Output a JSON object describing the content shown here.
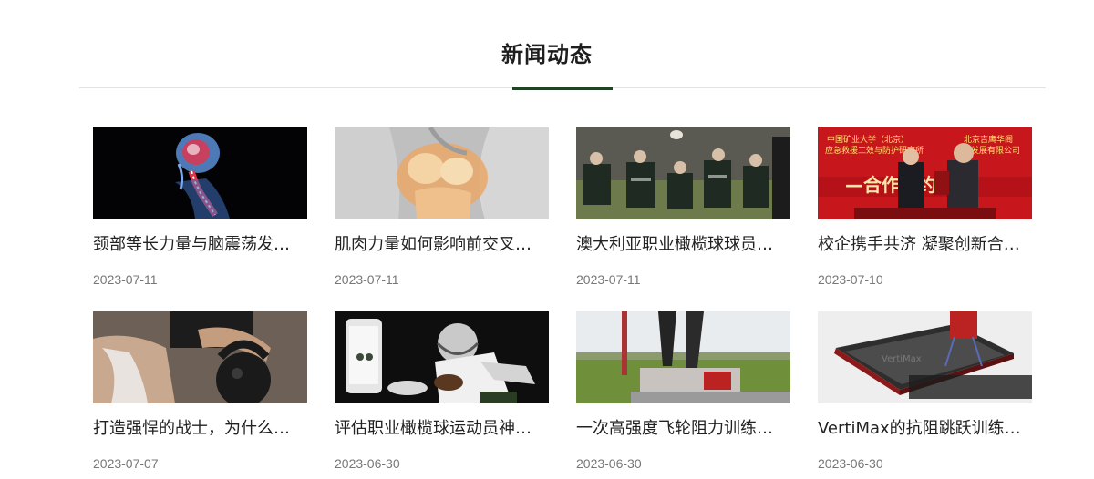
{
  "section": {
    "title": "新闻动态"
  },
  "news": [
    {
      "title": "颈部等长力量与脑震荡发…",
      "date": "2023-07-11",
      "image": "spine-brain-xray-image"
    },
    {
      "title": "肌肉力量如何影响前交叉…",
      "date": "2023-07-11",
      "image": "knee-joint-image"
    },
    {
      "title": "澳大利亚职业橄榄球球员…",
      "date": "2023-07-11",
      "image": "rugby-players-image"
    },
    {
      "title": "校企携手共济 凝聚创新合…",
      "date": "2023-07-10",
      "image": "partnership-signing-image"
    },
    {
      "title": "打造强悍的战士，为什么…",
      "date": "2023-07-07",
      "image": "kettlebell-training-image"
    },
    {
      "title": "评估职业橄榄球运动员神…",
      "date": "2023-06-30",
      "image": "football-player-phone-image"
    },
    {
      "title": "一次高强度飞轮阻力训练…",
      "date": "2023-06-30",
      "image": "flywheel-sled-image"
    },
    {
      "title": "VertiMax的抗阻跳跃训练…",
      "date": "2023-06-30",
      "image": "vertimax-platform-image"
    }
  ],
  "banner_text": {
    "left": "中国矿业大学（北京）\n应急救援工效与防护研究所",
    "right": "北京吉鹰华阁\n体育发展有限公司",
    "ribbon": "合作签约仪"
  },
  "colors": {
    "accent": "#1f4424",
    "date": "#777777",
    "title": "#222222",
    "banner_red": "#c8161d"
  }
}
